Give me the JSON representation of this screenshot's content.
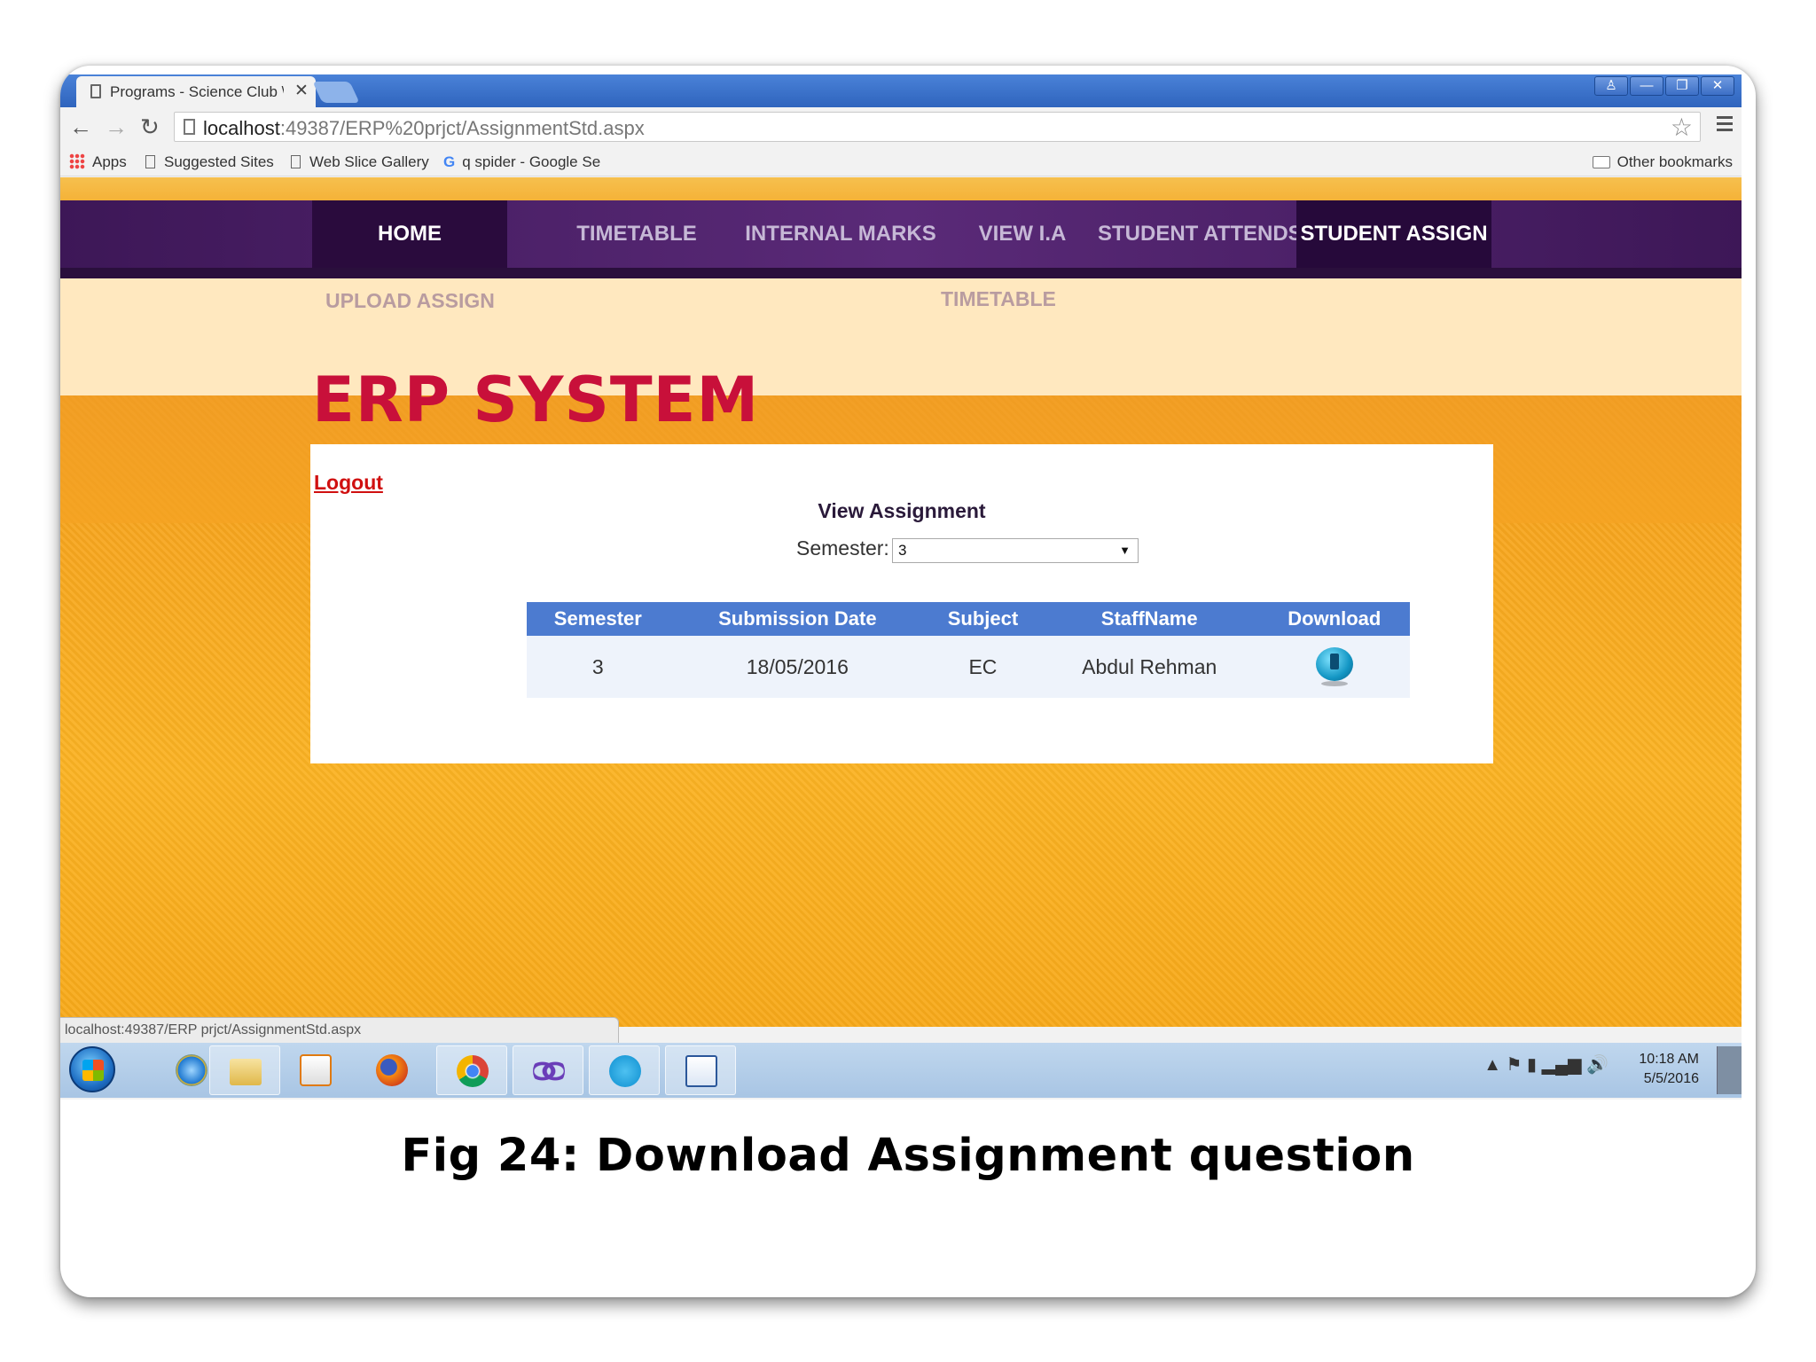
{
  "browser": {
    "tab_title": "Programs - Science Club \\",
    "tab_close": "✕",
    "window_buttons": [
      "♙",
      "—",
      "❐",
      "✕"
    ],
    "back_glyph": "←",
    "forward_glyph": "→",
    "reload_glyph": "↻",
    "url_host": "localhost",
    "url_rest": ":49387/ERP%20prjct/AssignmentStd.aspx",
    "star_glyph": "☆"
  },
  "bookmarks": {
    "apps": "Apps",
    "items": [
      "Suggested Sites",
      "Web Slice Gallery",
      "q spider - Google Se"
    ],
    "google_glyph": "G",
    "other": "Other bookmarks"
  },
  "site": {
    "menu": [
      "HOME",
      "TIMETABLE",
      "INTERNAL MARKS",
      "VIEW I.A",
      "STUDENT ATTENDS",
      "STUDENT ASSIGN"
    ],
    "submenu": [
      "UPLOAD ASSIGN",
      "TIMETABLE"
    ],
    "brand": "ERP SYSTEM",
    "logout": "Logout",
    "view_title": "View Assignment",
    "semester_label": "Semester:",
    "semester_value": "3",
    "select_arrow": "▼",
    "table": {
      "headers": [
        "Semester",
        "Submission Date",
        "Subject",
        "StaffName",
        "Download"
      ],
      "rows": [
        {
          "semester": "3",
          "date": "18/05/2016",
          "subject": "EC",
          "staff": "Abdul Rehman"
        }
      ]
    }
  },
  "status_url": "localhost:49387/ERP prjct/AssignmentStd.aspx",
  "taskbar": {
    "icons": [
      "windows-start-icon",
      "internet-explorer-icon",
      "file-explorer-icon",
      "media-player-icon",
      "firefox-icon",
      "chrome-icon",
      "visual-studio-icon",
      "skype-icon",
      "word-icon"
    ],
    "tray_glyphs": "▲  ⚑  ▮  ▂▄▆  🔊",
    "time": "10:18 AM",
    "date": "5/5/2016"
  },
  "caption": "Fig 24: Download Assignment question"
}
